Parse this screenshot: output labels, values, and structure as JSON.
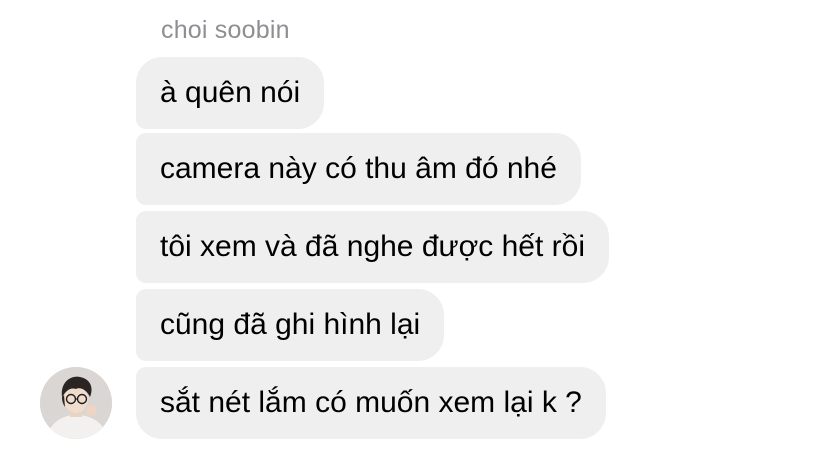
{
  "sender": {
    "name": "choi soobin"
  },
  "messages": [
    {
      "text": "à quên nói"
    },
    {
      "text": "camera này có thu âm đó nhé"
    },
    {
      "text": "tôi xem và đã nghe được hết rồi"
    },
    {
      "text": "cũng đã ghi hình lại"
    },
    {
      "text": "sắt nét lắm có muốn xem lại k ?"
    }
  ],
  "colors": {
    "bubble_background": "#efefef",
    "sender_name": "#8e8e93",
    "message_text": "#000000"
  },
  "icons": {
    "avatar": "profile-photo"
  }
}
